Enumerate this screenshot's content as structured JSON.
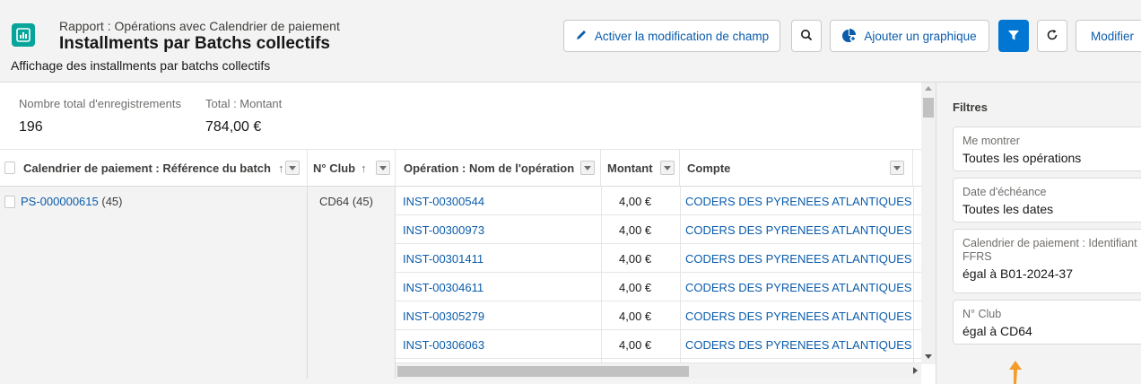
{
  "header": {
    "report_type": "Rapport : Opérations avec Calendrier de paiement",
    "title": "Installments par Batchs collectifs",
    "description": "Affichage des installments par batchs collectifs",
    "buttons": {
      "enable_field_edit": "Activer la modification de champ",
      "add_chart": "Ajouter un graphique",
      "edit": "Modifier"
    },
    "accent_color": "#0176d3",
    "app_icon_color": "#06a59a"
  },
  "summary": {
    "total_records_label": "Nombre total d'enregistrements",
    "total_records_value": "196",
    "total_amount_label": "Total : Montant",
    "total_amount_value": "784,00 €"
  },
  "table": {
    "columns": [
      {
        "label": "Calendrier de paiement : Référence du batch",
        "sort": "↑"
      },
      {
        "label": "N° Club",
        "sort": "↑"
      },
      {
        "label": "Opération : Nom de l'opération"
      },
      {
        "label": "Montant"
      },
      {
        "label": "Compte"
      }
    ],
    "group": {
      "batch_ref": "PS-000000615",
      "batch_count": "(45)",
      "club": "CD64 (45)"
    },
    "rows": [
      {
        "operation": "INST-00300544",
        "amount": "4,00 €",
        "account": "CODERS DES PYRENEES ATLANTIQUES"
      },
      {
        "operation": "INST-00300973",
        "amount": "4,00 €",
        "account": "CODERS DES PYRENEES ATLANTIQUES"
      },
      {
        "operation": "INST-00301411",
        "amount": "4,00 €",
        "account": "CODERS DES PYRENEES ATLANTIQUES"
      },
      {
        "operation": "INST-00304611",
        "amount": "4,00 €",
        "account": "CODERS DES PYRENEES ATLANTIQUES"
      },
      {
        "operation": "INST-00305279",
        "amount": "4,00 €",
        "account": "CODERS DES PYRENEES ATLANTIQUES"
      },
      {
        "operation": "INST-00306063",
        "amount": "4,00 €",
        "account": "CODERS DES PYRENEES ATLANTIQUES"
      }
    ]
  },
  "filters": {
    "title": "Filtres",
    "items": [
      {
        "label": "Me montrer",
        "value": "Toutes les opérations"
      },
      {
        "label": "Date d'échéance",
        "value": "Toutes les dates"
      },
      {
        "label": "Calendrier de paiement : Identifiant FFRS",
        "value": "égal à B01-2024-37"
      },
      {
        "label": "N° Club",
        "value": "égal à CD64"
      }
    ]
  }
}
